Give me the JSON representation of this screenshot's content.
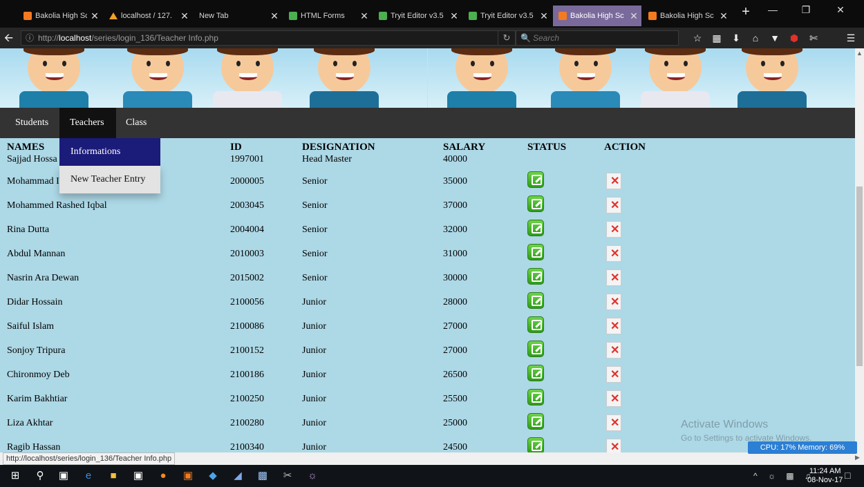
{
  "browser": {
    "tabs": [
      {
        "title": "Bakolia High Sc",
        "favicon": "xampp-icon",
        "active": false
      },
      {
        "title": "localhost / 127.",
        "favicon": "phpmyadmin-icon",
        "active": false
      },
      {
        "title": "New Tab",
        "favicon": "",
        "active": false
      },
      {
        "title": "HTML Forms",
        "favicon": "w3schools-icon",
        "active": false
      },
      {
        "title": "Tryit Editor v3.5",
        "favicon": "w3schools-icon",
        "active": false
      },
      {
        "title": "Tryit Editor v3.5",
        "favicon": "w3schools-icon",
        "active": false
      },
      {
        "title": "Bakolia High Sc",
        "favicon": "xampp-icon",
        "active": true
      },
      {
        "title": "Bakolia High Sc",
        "favicon": "xampp-icon",
        "active": false
      }
    ],
    "url_prefix": "http://",
    "url_host": "localhost",
    "url_path": "/series/login_136/Teacher Info.php",
    "search_placeholder": "Search",
    "status_url": "http://localhost/series/login_136/Teacher Info.php"
  },
  "menu": {
    "items": [
      "Students",
      "Teachers",
      "Class"
    ],
    "active": "Teachers",
    "dropdown": [
      "Informations",
      "New Teacher Entry"
    ]
  },
  "table": {
    "headers": [
      "NAMES",
      "ID",
      "DESIGNATION",
      "SALARY",
      "STATUS",
      "ACTION"
    ],
    "rows": [
      {
        "name": "Sajjad Hossa",
        "id": "1997001",
        "designation": "Head Master",
        "salary": "40000",
        "icons": false
      },
      {
        "name": "Mohammad I",
        "id": "2000005",
        "designation": "Senior",
        "salary": "35000",
        "icons": true
      },
      {
        "name": "Mohammed Rashed Iqbal",
        "id": "2003045",
        "designation": "Senior",
        "salary": "37000",
        "icons": true
      },
      {
        "name": "Rina Dutta",
        "id": "2004004",
        "designation": "Senior",
        "salary": "32000",
        "icons": true
      },
      {
        "name": "Abdul Mannan",
        "id": "2010003",
        "designation": "Senior",
        "salary": "31000",
        "icons": true
      },
      {
        "name": "Nasrin Ara Dewan",
        "id": "2015002",
        "designation": "Senior",
        "salary": "30000",
        "icons": true
      },
      {
        "name": "Didar Hossain",
        "id": "2100056",
        "designation": "Junior",
        "salary": "28000",
        "icons": true
      },
      {
        "name": "Saiful Islam",
        "id": "2100086",
        "designation": "Junior",
        "salary": "27000",
        "icons": true
      },
      {
        "name": "Sonjoy Tripura",
        "id": "2100152",
        "designation": "Junior",
        "salary": "27000",
        "icons": true
      },
      {
        "name": "Chironmoy Deb",
        "id": "2100186",
        "designation": "Junior",
        "salary": "26500",
        "icons": true
      },
      {
        "name": "Karim Bakhtiar",
        "id": "2100250",
        "designation": "Junior",
        "salary": "25500",
        "icons": true
      },
      {
        "name": "Liza Akhtar",
        "id": "2100280",
        "designation": "Junior",
        "salary": "25000",
        "icons": true
      },
      {
        "name": "Ragib Hassan",
        "id": "2100340",
        "designation": "Junior",
        "salary": "24500",
        "icons": true
      }
    ]
  },
  "overlay": {
    "activate_title": "Activate Windows",
    "activate_sub": "Go to Settings to activate Windows.",
    "cpu_memory": "CPU: 17%  Memory: 69%"
  },
  "taskbar": {
    "time": "11:24 AM",
    "date": "08-Nov-17"
  },
  "colors": {
    "page_bg": "#add8e6",
    "menu_bg": "#333333",
    "dropdown_active": "#1b1b7a"
  }
}
